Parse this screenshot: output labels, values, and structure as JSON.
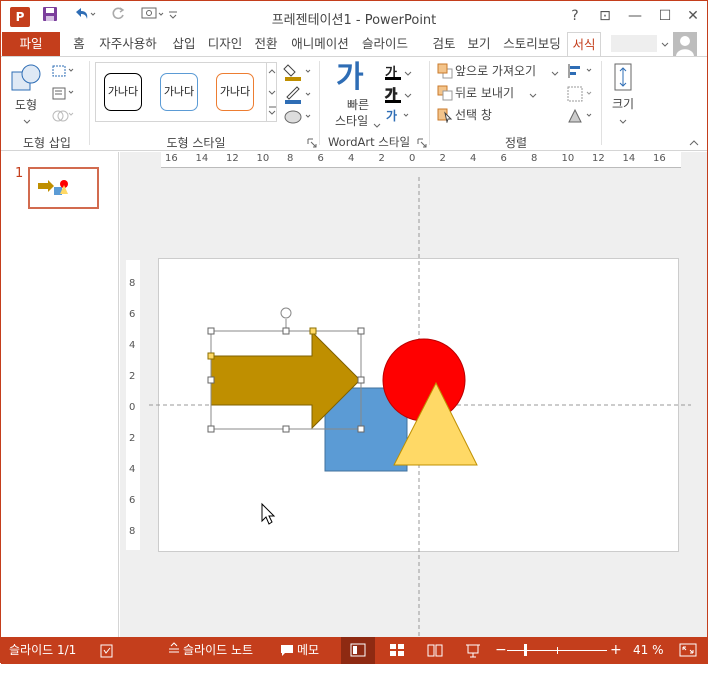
{
  "titlebar": {
    "app_icon": "P",
    "title": "프레젠테이션1 - PowerPoint",
    "help": "?",
    "restore": "⊡",
    "minimize": "—",
    "maximize": "☐",
    "close": "✕"
  },
  "tabs": [
    {
      "label": "파일"
    },
    {
      "label": "홈"
    },
    {
      "label": "자주사용하"
    },
    {
      "label": "삽입"
    },
    {
      "label": "디자인"
    },
    {
      "label": "전환"
    },
    {
      "label": "애니메이션"
    },
    {
      "label": "슬라이드"
    },
    {
      "label": "검토"
    },
    {
      "label": "보기"
    },
    {
      "label": "스토리보딩"
    },
    {
      "label": "서식"
    }
  ],
  "ribbon": {
    "insert_shapes": {
      "shape_label": "도형",
      "group_label": "도형 삽입"
    },
    "shape_styles": {
      "preset": [
        "가나다",
        "가나다",
        "가나다"
      ],
      "group_label": "도형 스타일"
    },
    "wordart": {
      "quick_label_1": "빠른",
      "quick_label_2": "스타일",
      "big_glyph": "가",
      "small_a": "가",
      "small_b": "가",
      "group_label": "WordArt 스타일"
    },
    "arrange": {
      "bring_forward": "앞으로 가져오기",
      "send_backward": "뒤로 보내기",
      "selection_pane": "선택 창",
      "group_label": "정렬"
    },
    "size": {
      "label": "크기"
    }
  },
  "slides_panel": {
    "slide_number": "1"
  },
  "ruler": {
    "h_labels": [
      "16",
      "14",
      "12",
      "10",
      "8",
      "6",
      "4",
      "2",
      "0",
      "2",
      "4",
      "6",
      "8",
      "10",
      "12",
      "14",
      "16"
    ],
    "v_labels": [
      "8",
      "6",
      "4",
      "2",
      "0",
      "2",
      "4",
      "6",
      "8"
    ]
  },
  "statusbar": {
    "slide_info": "슬라이드 1/1",
    "notes": "슬라이드 노트",
    "comments": "메모",
    "zoom": "41 %",
    "minus": "−",
    "plus": "+"
  },
  "colors": {
    "accent": "#c43e1c",
    "arrow": "#bf8f00",
    "square": "#5b9bd5",
    "circle": "#ff0000",
    "triangle": "#ffd966"
  }
}
